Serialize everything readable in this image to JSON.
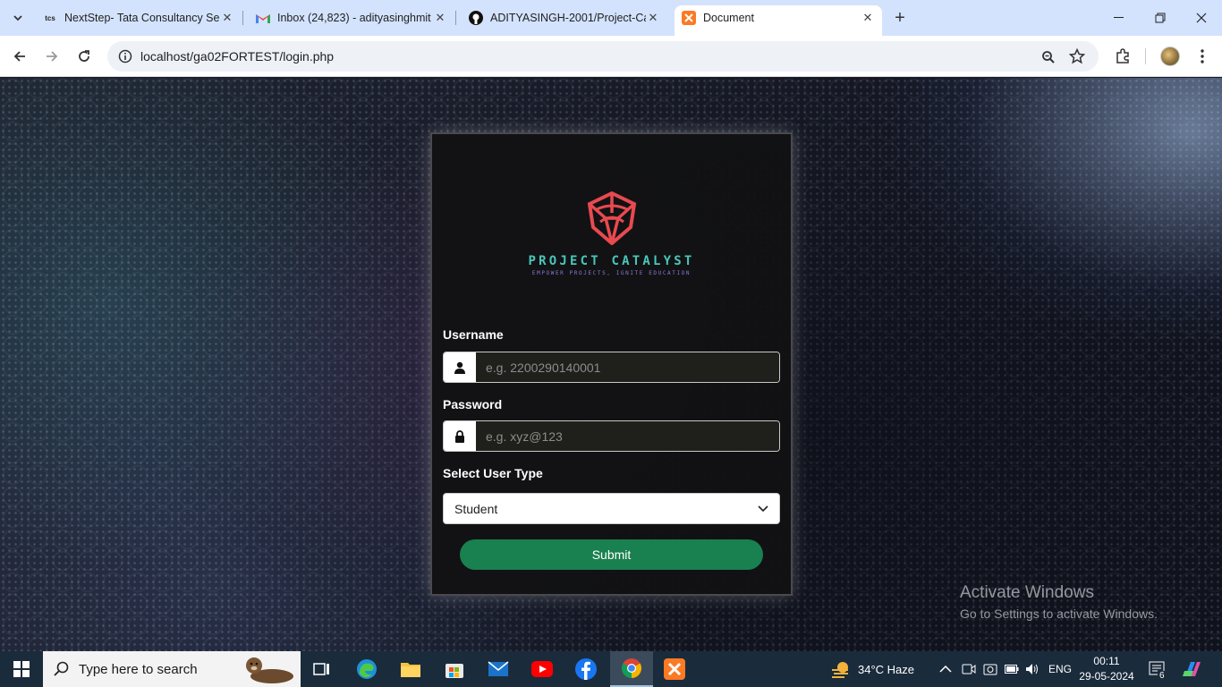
{
  "browser": {
    "tabs": [
      {
        "title": "NextStep- Tata Consultancy Ser",
        "favicon": "tcs-icon"
      },
      {
        "title": "Inbox (24,823) - adityasinghmit",
        "favicon": "gmail-icon"
      },
      {
        "title": "ADITYASINGH-2001/Project-Ca",
        "favicon": "github-icon"
      },
      {
        "title": "Document",
        "favicon": "xampp-icon",
        "active": true
      }
    ],
    "url": "localhost/ga02FORTEST/login.php"
  },
  "login": {
    "brand": "PROJECT CATALYST",
    "tagline": "EMPOWER PROJECTS, IGNITE EDUCATION",
    "username_label": "Username",
    "username_placeholder": "e.g. 2200290140001",
    "password_label": "Password",
    "password_placeholder": "e.g. xyz@123",
    "user_type_label": "Select User Type",
    "user_type_selected": "Student",
    "submit_label": "Submit",
    "colors": {
      "brand_teal": "#49c7b8",
      "logo_red": "#e84a4f",
      "submit_green": "#19804f"
    }
  },
  "watermark": {
    "title": "Activate Windows",
    "subtitle": "Go to Settings to activate Windows."
  },
  "taskbar": {
    "search_placeholder": "Type here to search",
    "weather": "34°C  Haze",
    "language": "ENG",
    "time": "00:11",
    "date": "29-05-2024",
    "notification_count": "6"
  }
}
